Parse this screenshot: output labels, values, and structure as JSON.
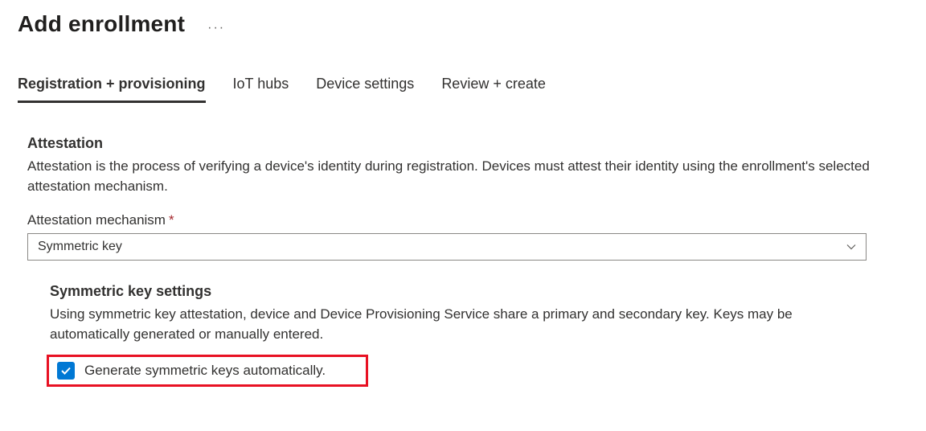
{
  "header": {
    "title": "Add enrollment",
    "more_glyph": "···"
  },
  "tabs": [
    {
      "label": "Registration + provisioning",
      "active": true
    },
    {
      "label": "IoT hubs",
      "active": false
    },
    {
      "label": "Device settings",
      "active": false
    },
    {
      "label": "Review + create",
      "active": false
    }
  ],
  "attestation": {
    "heading": "Attestation",
    "description": "Attestation is the process of verifying a device's identity during registration. Devices must attest their identity using the enrollment's selected attestation mechanism.",
    "field_label": "Attestation mechanism",
    "required_mark": "*",
    "selected_value": "Symmetric key"
  },
  "symmetric": {
    "heading": "Symmetric key settings",
    "description": "Using symmetric key attestation, device and Device Provisioning Service share a primary and secondary key. Keys may be automatically generated or manually entered.",
    "checkbox_label": "Generate symmetric keys automatically.",
    "checked": true
  }
}
